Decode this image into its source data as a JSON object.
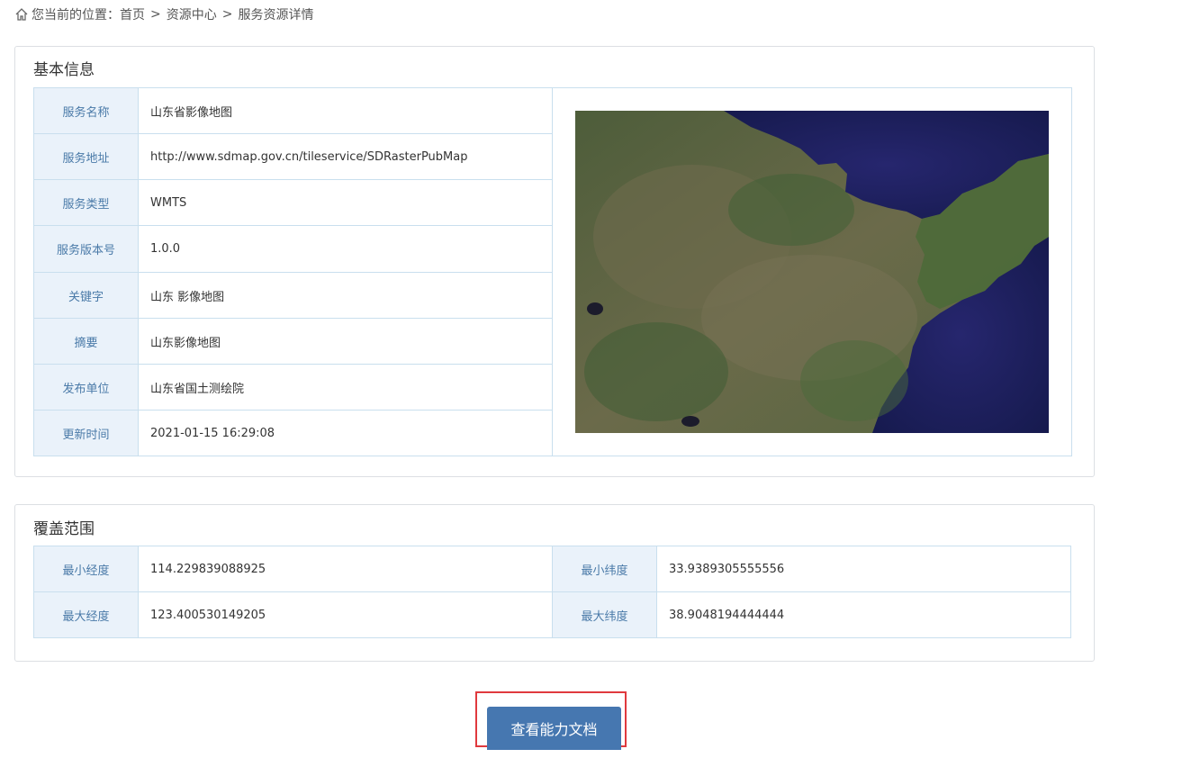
{
  "breadcrumb": {
    "prefix": "您当前的位置：",
    "items": [
      "首页",
      "资源中心",
      "服务资源详情"
    ],
    "separator": ">"
  },
  "basic_info": {
    "title": "基本信息",
    "rows": [
      {
        "label": "服务名称",
        "value": "山东省影像地图"
      },
      {
        "label": "服务地址",
        "value": "http://www.sdmap.gov.cn/tileservice/SDRasterPubMap"
      },
      {
        "label": "服务类型",
        "value": "WMTS"
      },
      {
        "label": "服务版本号",
        "value": "1.0.0"
      },
      {
        "label": "关键字",
        "value": "山东 影像地图"
      },
      {
        "label": "摘要",
        "value": "山东影像地图"
      },
      {
        "label": "发布单位",
        "value": "山东省国土测绘院"
      },
      {
        "label": "更新时间",
        "value": "2021-01-15 16:29:08"
      }
    ]
  },
  "coverage": {
    "title": "覆盖范围",
    "min_lon_label": "最小经度",
    "min_lon": "114.229839088925",
    "min_lat_label": "最小纬度",
    "min_lat": "33.9389305555556",
    "max_lon_label": "最大经度",
    "max_lon": "123.400530149205",
    "max_lat_label": "最大纬度",
    "max_lat": "38.9048194444444"
  },
  "action": {
    "label": "查看能力文档"
  },
  "colors": {
    "accent": "#4677b0",
    "label_bg": "#eaf2fa",
    "label_text": "#4a7aa8",
    "highlight": "#e0393e",
    "border": "#c9dfee"
  }
}
